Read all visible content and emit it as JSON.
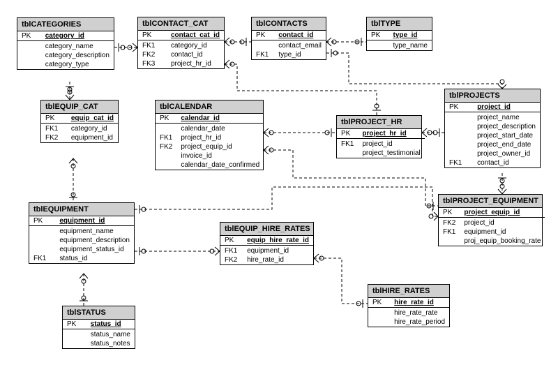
{
  "entities": {
    "categories": {
      "title": "tblCATEGORIES",
      "pk_label": "PK",
      "pk_field": "category_id",
      "fields": [
        "category_name",
        "category_description",
        "category_type"
      ]
    },
    "contact_cat": {
      "title": "tblCONTACT_CAT",
      "pk_label": "PK",
      "pk_field": "contact_cat_id",
      "fk_labels": [
        "FK1",
        "FK2",
        "FK3"
      ],
      "fields": [
        "category_id",
        "contact_id",
        "project_hr_id"
      ]
    },
    "contacts": {
      "title": "tblCONTACTS",
      "pk_label": "PK",
      "pk_field": "contact_id",
      "fk_labels": [
        "",
        "FK1"
      ],
      "fields": [
        "contact_email",
        "type_id"
      ]
    },
    "type": {
      "title": "tblTYPE",
      "pk_label": "PK",
      "pk_field": "type_id",
      "fields": [
        "type_name"
      ]
    },
    "equip_cat": {
      "title": "tblEQUIP_CAT",
      "pk_label": "PK",
      "pk_field": "equip_cat_id",
      "fk_labels": [
        "FK1",
        "FK2"
      ],
      "fields": [
        "category_id",
        "equipment_id"
      ]
    },
    "calendar": {
      "title": "tblCALENDAR",
      "pk_label": "PK",
      "pk_field": "calendar_id",
      "fk_labels": [
        "",
        "FK1",
        "FK2",
        "",
        ""
      ],
      "fields": [
        "calendar_date",
        "project_hr_id",
        "project_equip_id",
        "invoice_id",
        "calendar_date_confirmed"
      ]
    },
    "project_hr": {
      "title": "tblPROJECT_HR",
      "pk_label": "PK",
      "pk_field": "project_hr_id",
      "fk_labels": [
        "FK1",
        ""
      ],
      "fields": [
        "project_id",
        "project_testimonial"
      ]
    },
    "projects": {
      "title": "tblPROJECTS",
      "pk_label": "PK",
      "pk_field": "project_id",
      "fk_labels": [
        "",
        "",
        "",
        "",
        "",
        "FK1"
      ],
      "fields": [
        "project_name",
        "project_description",
        "project_start_date",
        "project_end_date",
        "project_owner_id",
        "contact_id"
      ]
    },
    "equipment": {
      "title": "tblEQUIPMENT",
      "pk_label": "PK",
      "pk_field": "equipment_id",
      "fk_labels": [
        "",
        "",
        "",
        "FK1"
      ],
      "fields": [
        "equipment_name",
        "equipment_description",
        "equipment_status_id",
        "status_id"
      ]
    },
    "equip_hire_rates": {
      "title": "tblEQUIP_HIRE_RATES",
      "pk_label": "PK",
      "pk_field": "equip_hire_rate_id",
      "fk_labels": [
        "FK1",
        "FK2"
      ],
      "fields": [
        "equipment_id",
        "hire_rate_id"
      ]
    },
    "project_equipment": {
      "title": "tblPROJECT_EQUIPMENT",
      "pk_label": "PK",
      "pk_field": "project_equip_id",
      "fk_labels": [
        "FK2",
        "FK1",
        ""
      ],
      "fields": [
        "project_id",
        "equipment_id",
        "proj_equip_booking_rate"
      ]
    },
    "status": {
      "title": "tblSTATUS",
      "pk_label": "PK",
      "pk_field": "status_id",
      "fields": [
        "status_name",
        "status_notes"
      ]
    },
    "hire_rates": {
      "title": "tblHIRE_RATES",
      "pk_label": "PK",
      "pk_field": "hire_rate_id",
      "fields": [
        "hire_rate_rate",
        "hire_rate_period"
      ]
    }
  }
}
